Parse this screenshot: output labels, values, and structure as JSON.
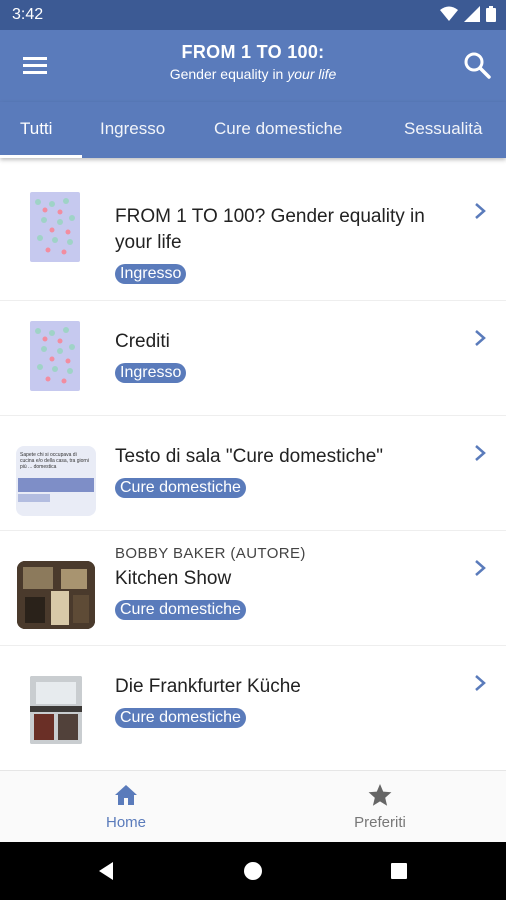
{
  "status": {
    "time": "3:42"
  },
  "header": {
    "title": "FROM 1 TO 100:",
    "subtitle_prefix": "Gender equality in ",
    "subtitle_em": "your life"
  },
  "tabs": [
    {
      "label": "Tutti",
      "active": true
    },
    {
      "label": "Ingresso"
    },
    {
      "label": "Cure domestiche"
    },
    {
      "label": "Sessualità"
    }
  ],
  "items": [
    {
      "name": "FROM 1 TO 100? Gender equality in your life",
      "tag": "Ingresso",
      "thumb": "poster"
    },
    {
      "name": "Crediti",
      "tag": "Ingresso",
      "thumb": "poster"
    },
    {
      "name": "Testo di sala \"Cure domestiche\"",
      "tag": "Cure domestiche",
      "thumb": "text",
      "thumb_text": "Sapete chi si occupava di cucina e/o della casa, tra giorni più ... domestica"
    },
    {
      "author": "BOBBY BAKER (AUTORE)",
      "name": "Kitchen Show",
      "tag": "Cure domestiche",
      "thumb": "photo-dark"
    },
    {
      "name": "Die Frankfurter Küche",
      "tag": "Cure domestiche",
      "thumb": "photo-kitchen"
    }
  ],
  "bottom_nav": [
    {
      "label": "Home",
      "icon": "home-icon",
      "active": true
    },
    {
      "label": "Preferiti",
      "icon": "star-icon"
    }
  ],
  "colors": {
    "primary": "#5a7bbb",
    "status_bar": "#3c5a94",
    "badge": "#5a7bbb"
  }
}
